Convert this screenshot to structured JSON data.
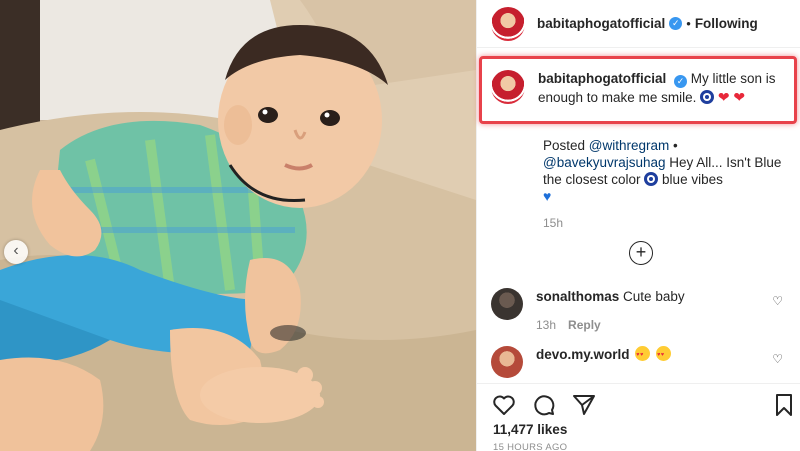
{
  "post": {
    "author": "babitaphogatofficial",
    "dot": "•",
    "follow_status": "Following"
  },
  "caption": {
    "author": "babitaphogatofficial",
    "text": "My little son is enough to make me smile."
  },
  "repost": {
    "prefix": "Posted ",
    "mention_app": "@withregram",
    "bullet": " •",
    "mention_user": "@bavekyuvrajsuhag",
    "text": " Hey All... Isn't Blue the closest color ",
    "text_tail": " blue vibes",
    "time": "15h"
  },
  "comments": [
    {
      "user": "sonalthomas",
      "text": "Cute baby",
      "time": "13h",
      "reply": "Reply"
    },
    {
      "user": "devo.my.world",
      "text": ""
    }
  ],
  "stats": {
    "likes": "11,477 likes",
    "ago": "15 HOURS AGO"
  },
  "icons": {
    "verified": "✓",
    "heart": "♡",
    "plus": "+",
    "prev": "‹",
    "red_heart": "❤",
    "blue_heart": "♥"
  },
  "colors": {
    "highlight": "#e8424b",
    "link": "#00376b",
    "verified": "#3897f0",
    "muted": "#8e8e8e"
  }
}
